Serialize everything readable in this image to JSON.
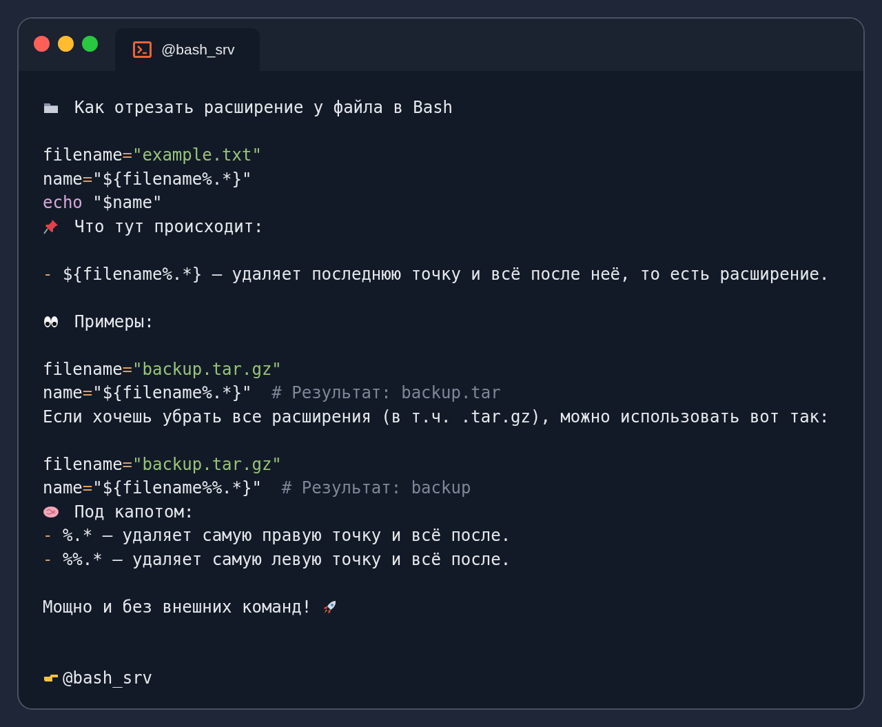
{
  "window": {
    "tab": {
      "label": "@bash_srv"
    }
  },
  "lines": [
    {
      "kind": "text",
      "tokens": [
        {
          "kind": "plain",
          "text": "Как отрезать расширение у файла в Bash"
        }
      ]
    },
    {
      "kind": "blank"
    },
    {
      "kind": "code",
      "tokens": [
        {
          "kind": "plain",
          "text": "filename"
        },
        {
          "kind": "op",
          "text": "="
        },
        {
          "kind": "string",
          "text": "\"example.txt\""
        }
      ]
    },
    {
      "kind": "code",
      "tokens": [
        {
          "kind": "plain",
          "text": "name"
        },
        {
          "kind": "op",
          "text": "="
        },
        {
          "kind": "plain",
          "text": "\"${filename%.*}\""
        }
      ]
    },
    {
      "kind": "code",
      "tokens": [
        {
          "kind": "keyword",
          "text": "echo"
        },
        {
          "kind": "plain",
          "text": " \"$name\""
        }
      ]
    },
    {
      "kind": "text",
      "tokens": [
        {
          "kind": "plain",
          "text": "Что тут происходит:"
        }
      ]
    },
    {
      "kind": "blank"
    },
    {
      "kind": "text",
      "tokens": [
        {
          "kind": "bullet",
          "text": "-"
        },
        {
          "kind": "plain",
          "text": " ${filename%.*} — удаляет последнюю точку и всё после неё, то есть расширение."
        }
      ]
    },
    {
      "kind": "blank"
    },
    {
      "kind": "text",
      "tokens": [
        {
          "kind": "plain",
          "text": "Примеры:"
        }
      ]
    },
    {
      "kind": "blank"
    },
    {
      "kind": "code",
      "tokens": [
        {
          "kind": "plain",
          "text": "filename"
        },
        {
          "kind": "op",
          "text": "="
        },
        {
          "kind": "string",
          "text": "\"backup.tar.gz\""
        }
      ]
    },
    {
      "kind": "code",
      "tokens": [
        {
          "kind": "plain",
          "text": "name"
        },
        {
          "kind": "op",
          "text": "="
        },
        {
          "kind": "plain",
          "text": "\"${filename%.*}\"  "
        },
        {
          "kind": "comment",
          "text": "# Результат: backup.tar"
        }
      ]
    },
    {
      "kind": "text",
      "tokens": [
        {
          "kind": "plain",
          "text": "Если хочешь убрать все расширения (в т.ч. .tar.gz), можно использовать вот так:"
        }
      ]
    },
    {
      "kind": "blank"
    },
    {
      "kind": "code",
      "tokens": [
        {
          "kind": "plain",
          "text": "filename"
        },
        {
          "kind": "op",
          "text": "="
        },
        {
          "kind": "string",
          "text": "\"backup.tar.gz\""
        }
      ]
    },
    {
      "kind": "code",
      "tokens": [
        {
          "kind": "plain",
          "text": "name"
        },
        {
          "kind": "op",
          "text": "="
        },
        {
          "kind": "plain",
          "text": "\"${filename%%.*}\"  "
        },
        {
          "kind": "comment",
          "text": "# Результат: backup"
        }
      ]
    },
    {
      "kind": "text",
      "tokens": [
        {
          "kind": "plain",
          "text": "Под капотом:"
        }
      ]
    },
    {
      "kind": "text",
      "tokens": [
        {
          "kind": "bullet",
          "text": "-"
        },
        {
          "kind": "plain",
          "text": " %.* — удаляет самую правую точку и всё после."
        }
      ]
    },
    {
      "kind": "text",
      "tokens": [
        {
          "kind": "bullet",
          "text": "-"
        },
        {
          "kind": "plain",
          "text": " %%.* — удаляет самую левую точку и всё после."
        }
      ]
    },
    {
      "kind": "blank"
    },
    {
      "kind": "text",
      "tokens": [
        {
          "kind": "plain",
          "text": "Мощно и без внешних команд! "
        }
      ]
    },
    {
      "kind": "blank"
    },
    {
      "kind": "blank"
    },
    {
      "kind": "text",
      "tokens": [
        {
          "kind": "plain",
          "text": "@bash_srv"
        }
      ]
    }
  ]
}
